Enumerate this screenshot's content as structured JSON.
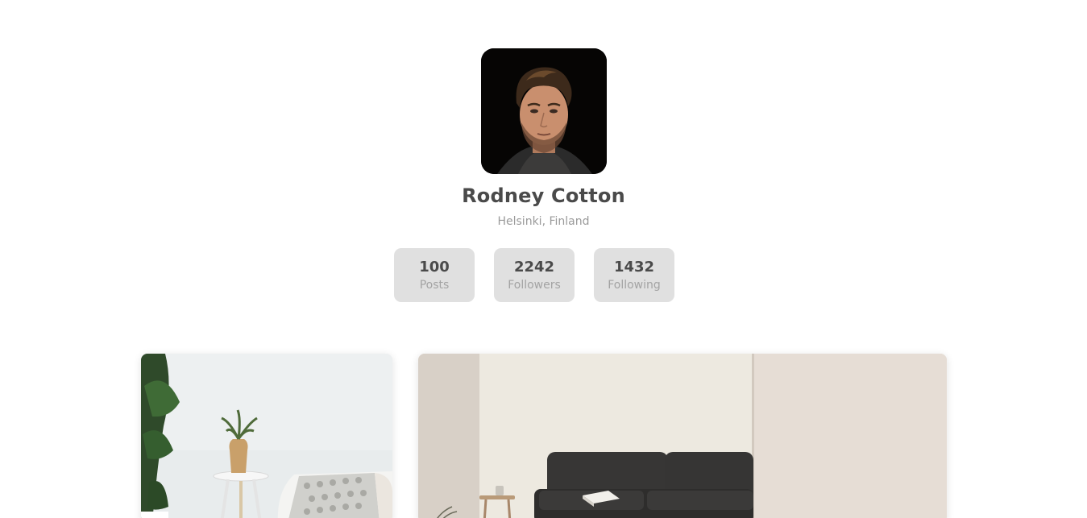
{
  "profile": {
    "name": "Rodney Cotton",
    "location": "Helsinki, Finland"
  },
  "stats": [
    {
      "value": "100",
      "label": "Posts"
    },
    {
      "value": "2242",
      "label": "Followers"
    },
    {
      "value": "1432",
      "label": "Following"
    }
  ],
  "colors": {
    "text_primary": "#4a4a4a",
    "text_secondary": "#9a9a9a",
    "stat_background": "#e0e0e0"
  }
}
